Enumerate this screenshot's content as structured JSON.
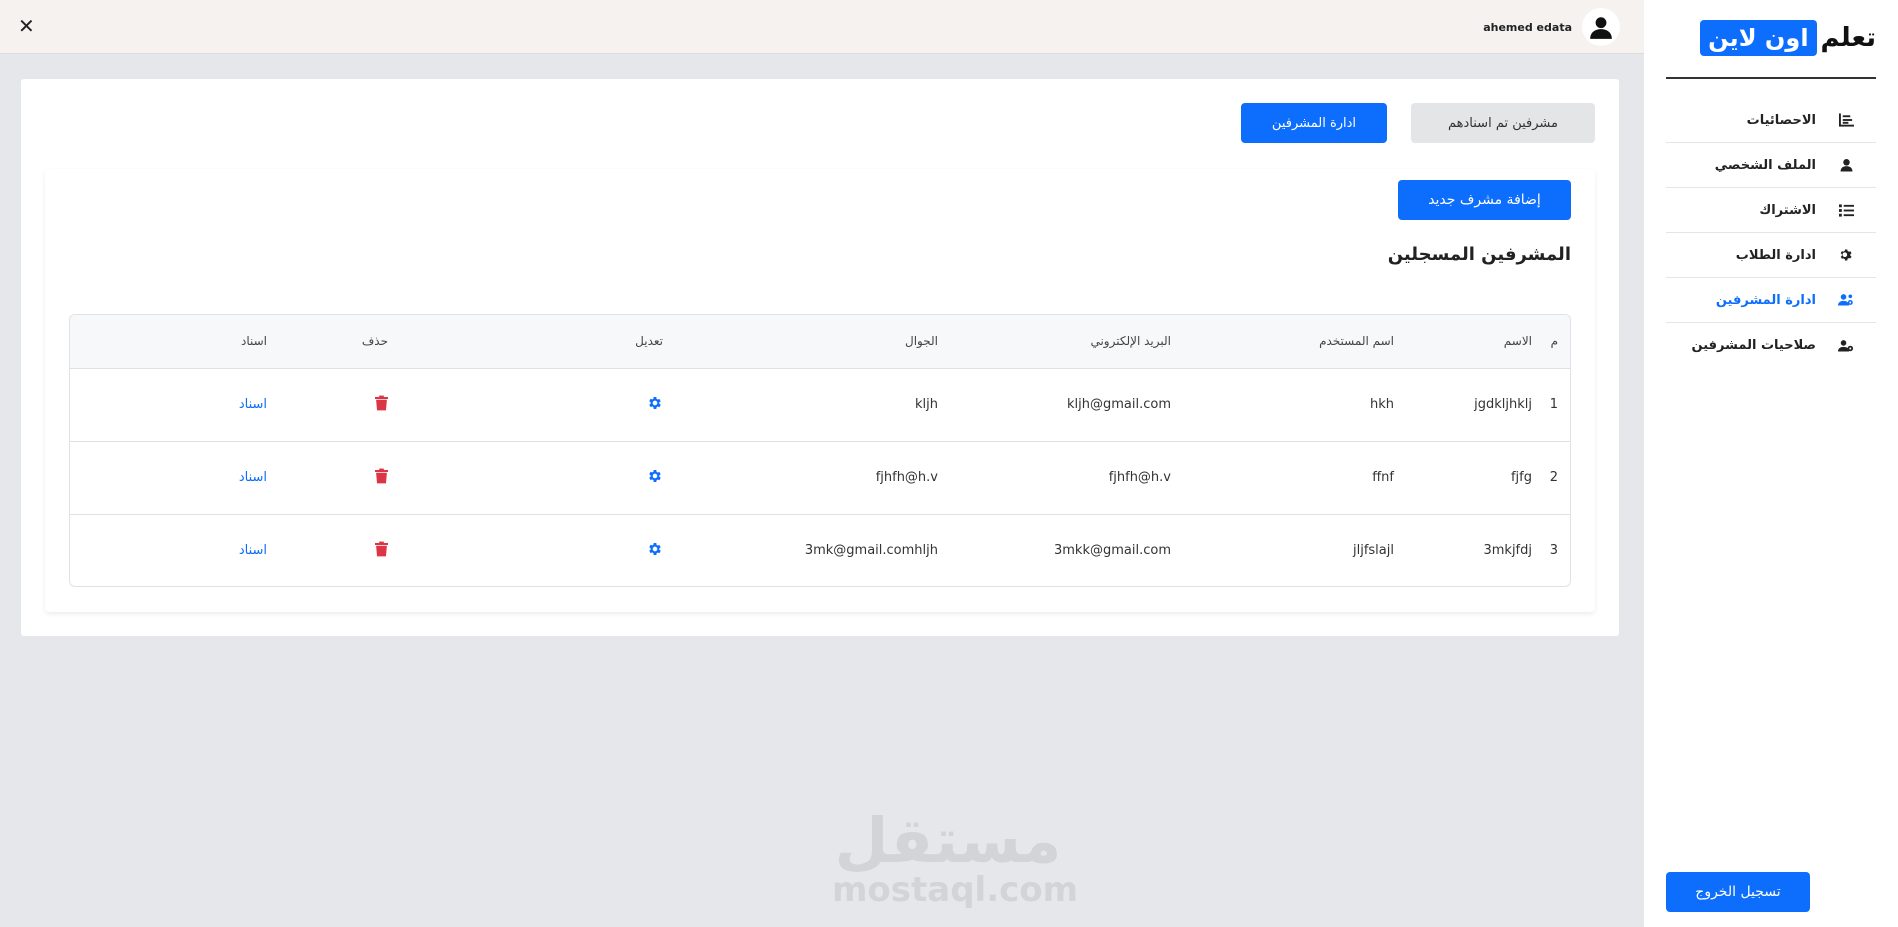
{
  "brand": {
    "part1": "تعلم",
    "part2": "اون لاين"
  },
  "sidebar": {
    "items": [
      {
        "label": "الاحصائيات",
        "icon": "chart-icon",
        "active": false
      },
      {
        "label": "الملف الشخصي",
        "icon": "user-icon",
        "active": false
      },
      {
        "label": "الاشتراك",
        "icon": "list-icon",
        "active": false
      },
      {
        "label": "ادارة الطلاب",
        "icon": "gear-icon",
        "active": false
      },
      {
        "label": "ادارة المشرفين",
        "icon": "users-icon",
        "active": true
      },
      {
        "label": "صلاحيات المشرفين",
        "icon": "user-gear-icon",
        "active": false
      }
    ],
    "logout_label": "تسجيل الخروج"
  },
  "topbar": {
    "username": "ahemed edata",
    "close_symbol": "✕"
  },
  "tabs": {
    "assigned": "مشرفين تم اسنادهم",
    "manage": "ادارة المشرفين"
  },
  "main": {
    "add_button": "إضافة مشرف جديد",
    "section_title": "المشرفين المسجلين",
    "columns": {
      "num": "م",
      "name": "الاسم",
      "username": "اسم المستخدم",
      "email": "البريد الإلكتروني",
      "phone": "الجوال",
      "edit": "تعديل",
      "delete": "حذف",
      "assign": "اسناد"
    },
    "rows": [
      {
        "num": "1",
        "name": "jgdkljhklj",
        "username": "hkh",
        "email": "kljh@gmail.com",
        "phone": "kljh",
        "assign": "اسناد"
      },
      {
        "num": "2",
        "name": "fjfg",
        "username": "ffnf",
        "email": "fjhfh@h.v",
        "phone": "fjhfh@h.v",
        "assign": "اسناد"
      },
      {
        "num": "3",
        "name": "3mkjfdj",
        "username": "jljfslajl",
        "email": "3mkk@gmail.com",
        "phone": "3mk@gmail.comhljh",
        "assign": "اسناد"
      }
    ]
  },
  "watermark": {
    "arabic": "مستقل",
    "latin": "mostaql.com"
  },
  "colors": {
    "accent": "#0d6efd",
    "danger": "#dc3545",
    "background": "#e6e7ea"
  }
}
